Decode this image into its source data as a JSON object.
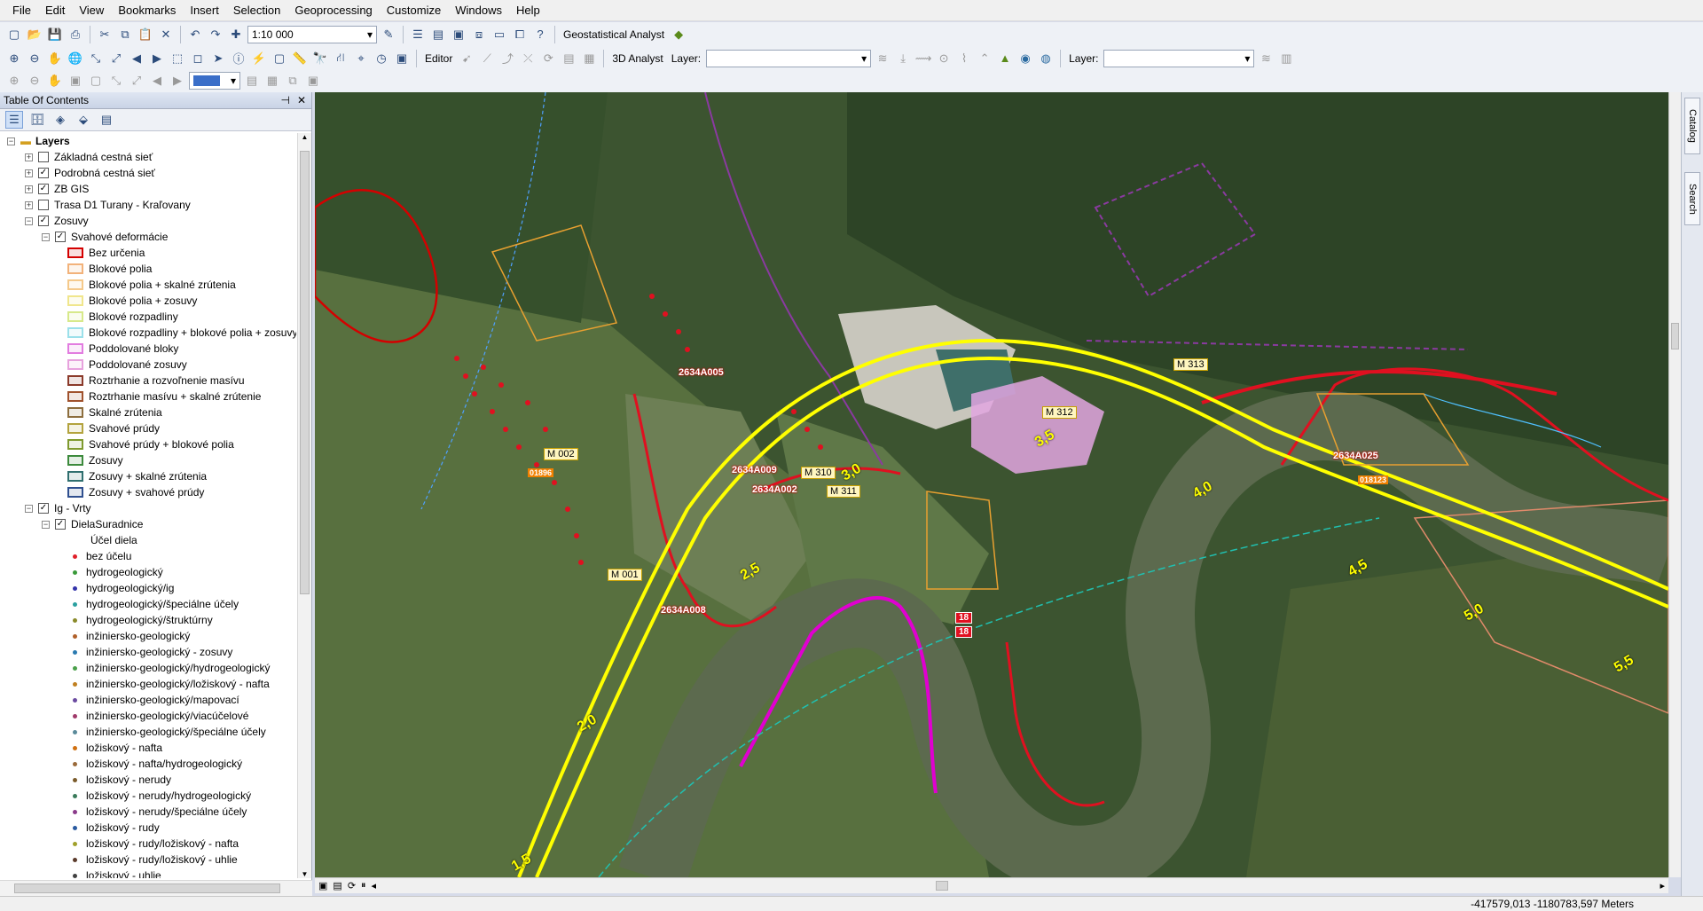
{
  "menu": [
    "File",
    "Edit",
    "View",
    "Bookmarks",
    "Insert",
    "Selection",
    "Geoprocessing",
    "Customize",
    "Windows",
    "Help"
  ],
  "toolbar": {
    "scale": "1:10 000",
    "geostat": "Geostatistical Analyst",
    "editor": "Editor",
    "analyst3d": "3D Analyst",
    "layer_label": "Layer:",
    "layer_label2": "Layer:"
  },
  "toc": {
    "title": "Table Of Contents",
    "root": "Layers",
    "items": [
      {
        "type": "layer",
        "indent": 0,
        "expander": "+",
        "checked": false,
        "label": "Základná cestná sieť"
      },
      {
        "type": "layer",
        "indent": 0,
        "expander": "+",
        "checked": true,
        "label": "Podrobná cestná sieť"
      },
      {
        "type": "layer",
        "indent": 0,
        "expander": "+",
        "checked": true,
        "label": "ZB GIS"
      },
      {
        "type": "layer",
        "indent": 0,
        "expander": "+",
        "checked": false,
        "label": "Trasa D1 Turany - Kraľovany"
      },
      {
        "type": "layer",
        "indent": 0,
        "expander": "-",
        "checked": true,
        "label": "Zosuvy"
      },
      {
        "type": "layer",
        "indent": 1,
        "expander": "-",
        "checked": true,
        "label": "Svahové deformácie"
      },
      {
        "type": "swatch",
        "color": "#d40000",
        "label": "Bez určenia"
      },
      {
        "type": "swatch",
        "color": "#f2b27a",
        "label": "Blokové polia"
      },
      {
        "type": "swatch",
        "color": "#f5c98a",
        "label": "Blokové polia + skalné zrútenia"
      },
      {
        "type": "swatch",
        "color": "#f0e68c",
        "label": "Blokové polia + zosuvy"
      },
      {
        "type": "swatch",
        "color": "#d7e98a",
        "label": "Blokové rozpadliny"
      },
      {
        "type": "swatch",
        "color": "#9be0ea",
        "label": "Blokové rozpadliny + blokové polia + zosuvy"
      },
      {
        "type": "swatch",
        "color": "#e27ce0",
        "label": "Poddolované bloky"
      },
      {
        "type": "swatch",
        "color": "#e7a2dd",
        "label": "Poddolované zosuvy"
      },
      {
        "type": "swatch",
        "color": "#8b3a2a",
        "label": "Roztrhanie a rozvoľnenie masívu"
      },
      {
        "type": "swatch",
        "color": "#a0522d",
        "label": "Roztrhanie masívu + skalné zrútenie"
      },
      {
        "type": "swatch",
        "color": "#8d6e3e",
        "label": "Skalné zrútenia"
      },
      {
        "type": "swatch",
        "color": "#b3a33e",
        "label": "Svahové prúdy"
      },
      {
        "type": "swatch",
        "color": "#7f9a2e",
        "label": "Svahové prúdy + blokové polia"
      },
      {
        "type": "swatch",
        "color": "#3c8a3c",
        "label": "Zosuvy"
      },
      {
        "type": "swatch",
        "color": "#2f6f6f",
        "label": "Zosuvy + skalné zrútenia"
      },
      {
        "type": "swatch",
        "color": "#2f4f8f",
        "label": "Zosuvy + svahové prúdy"
      },
      {
        "type": "layer",
        "indent": 0,
        "expander": "-",
        "checked": true,
        "label": "Ig - Vrty"
      },
      {
        "type": "layer",
        "indent": 1,
        "expander": "-",
        "checked": true,
        "label": "DielaSuradnice"
      },
      {
        "type": "heading",
        "label": "Účel diela"
      },
      {
        "type": "dot",
        "color": "#e0202a",
        "label": "bez účelu"
      },
      {
        "type": "dot",
        "color": "#3a9a3a",
        "label": "hydrogeologický"
      },
      {
        "type": "dot",
        "color": "#3333aa",
        "label": "hydrogeologický/ig"
      },
      {
        "type": "dot",
        "color": "#2aa0a0",
        "label": "hydrogeologický/špeciálne účely"
      },
      {
        "type": "dot",
        "color": "#8a8a2a",
        "label": "hydrogeologický/štruktúrny"
      },
      {
        "type": "dot",
        "color": "#b0602a",
        "label": "inžiniersko-geologický"
      },
      {
        "type": "dot",
        "color": "#2a7ab0",
        "label": "inžiniersko-geologický - zosuvy"
      },
      {
        "type": "dot",
        "color": "#4aa04a",
        "label": "inžiniersko-geologický/hydrogeologický"
      },
      {
        "type": "dot",
        "color": "#c08020",
        "label": "inžiniersko-geologický/ložiskový - nafta"
      },
      {
        "type": "dot",
        "color": "#6a4aa0",
        "label": "inžiniersko-geologický/mapovací"
      },
      {
        "type": "dot",
        "color": "#a03a6a",
        "label": "inžiniersko-geologický/viacúčelové"
      },
      {
        "type": "dot",
        "color": "#5a8a9a",
        "label": "inžiniersko-geologický/špeciálne účely"
      },
      {
        "type": "dot",
        "color": "#d07010",
        "label": "ložiskový - nafta"
      },
      {
        "type": "dot",
        "color": "#9a6a3a",
        "label": "ložiskový - nafta/hydrogeologický"
      },
      {
        "type": "dot",
        "color": "#7a5a2a",
        "label": "ložiskový - nerudy"
      },
      {
        "type": "dot",
        "color": "#3a7a5a",
        "label": "ložiskový - nerudy/hydrogeologický"
      },
      {
        "type": "dot",
        "color": "#8a3a8a",
        "label": "ložiskový - nerudy/špeciálne účely"
      },
      {
        "type": "dot",
        "color": "#2a5aa0",
        "label": "ložiskový - rudy"
      },
      {
        "type": "dot",
        "color": "#a0a02a",
        "label": "ložiskový - rudy/ložiskový - nafta"
      },
      {
        "type": "dot",
        "color": "#5a3a2a",
        "label": "ložiskový - rudy/ložiskový - uhlie"
      },
      {
        "type": "dot",
        "color": "#404040",
        "label": "ložiskový - uhlie"
      }
    ]
  },
  "map": {
    "chainage": [
      "1,5",
      "2,0",
      "2,5",
      "3,0",
      "3,5",
      "4,0",
      "4,5",
      "5,0",
      "5,5"
    ],
    "markers": [
      "M 001",
      "M 002",
      "M 310",
      "M 311",
      "M 312",
      "M 313"
    ],
    "boreholes": [
      "2634A008",
      "2634A009",
      "2634A002",
      "2634A025",
      "2634A005"
    ],
    "road_badges": [
      "18",
      "18"
    ],
    "orange_tags": [
      "01896",
      "018123"
    ]
  },
  "dock": {
    "catalog": "Catalog",
    "search": "Search"
  },
  "status": {
    "coords": "-417579,013  -1180783,597 Meters"
  }
}
